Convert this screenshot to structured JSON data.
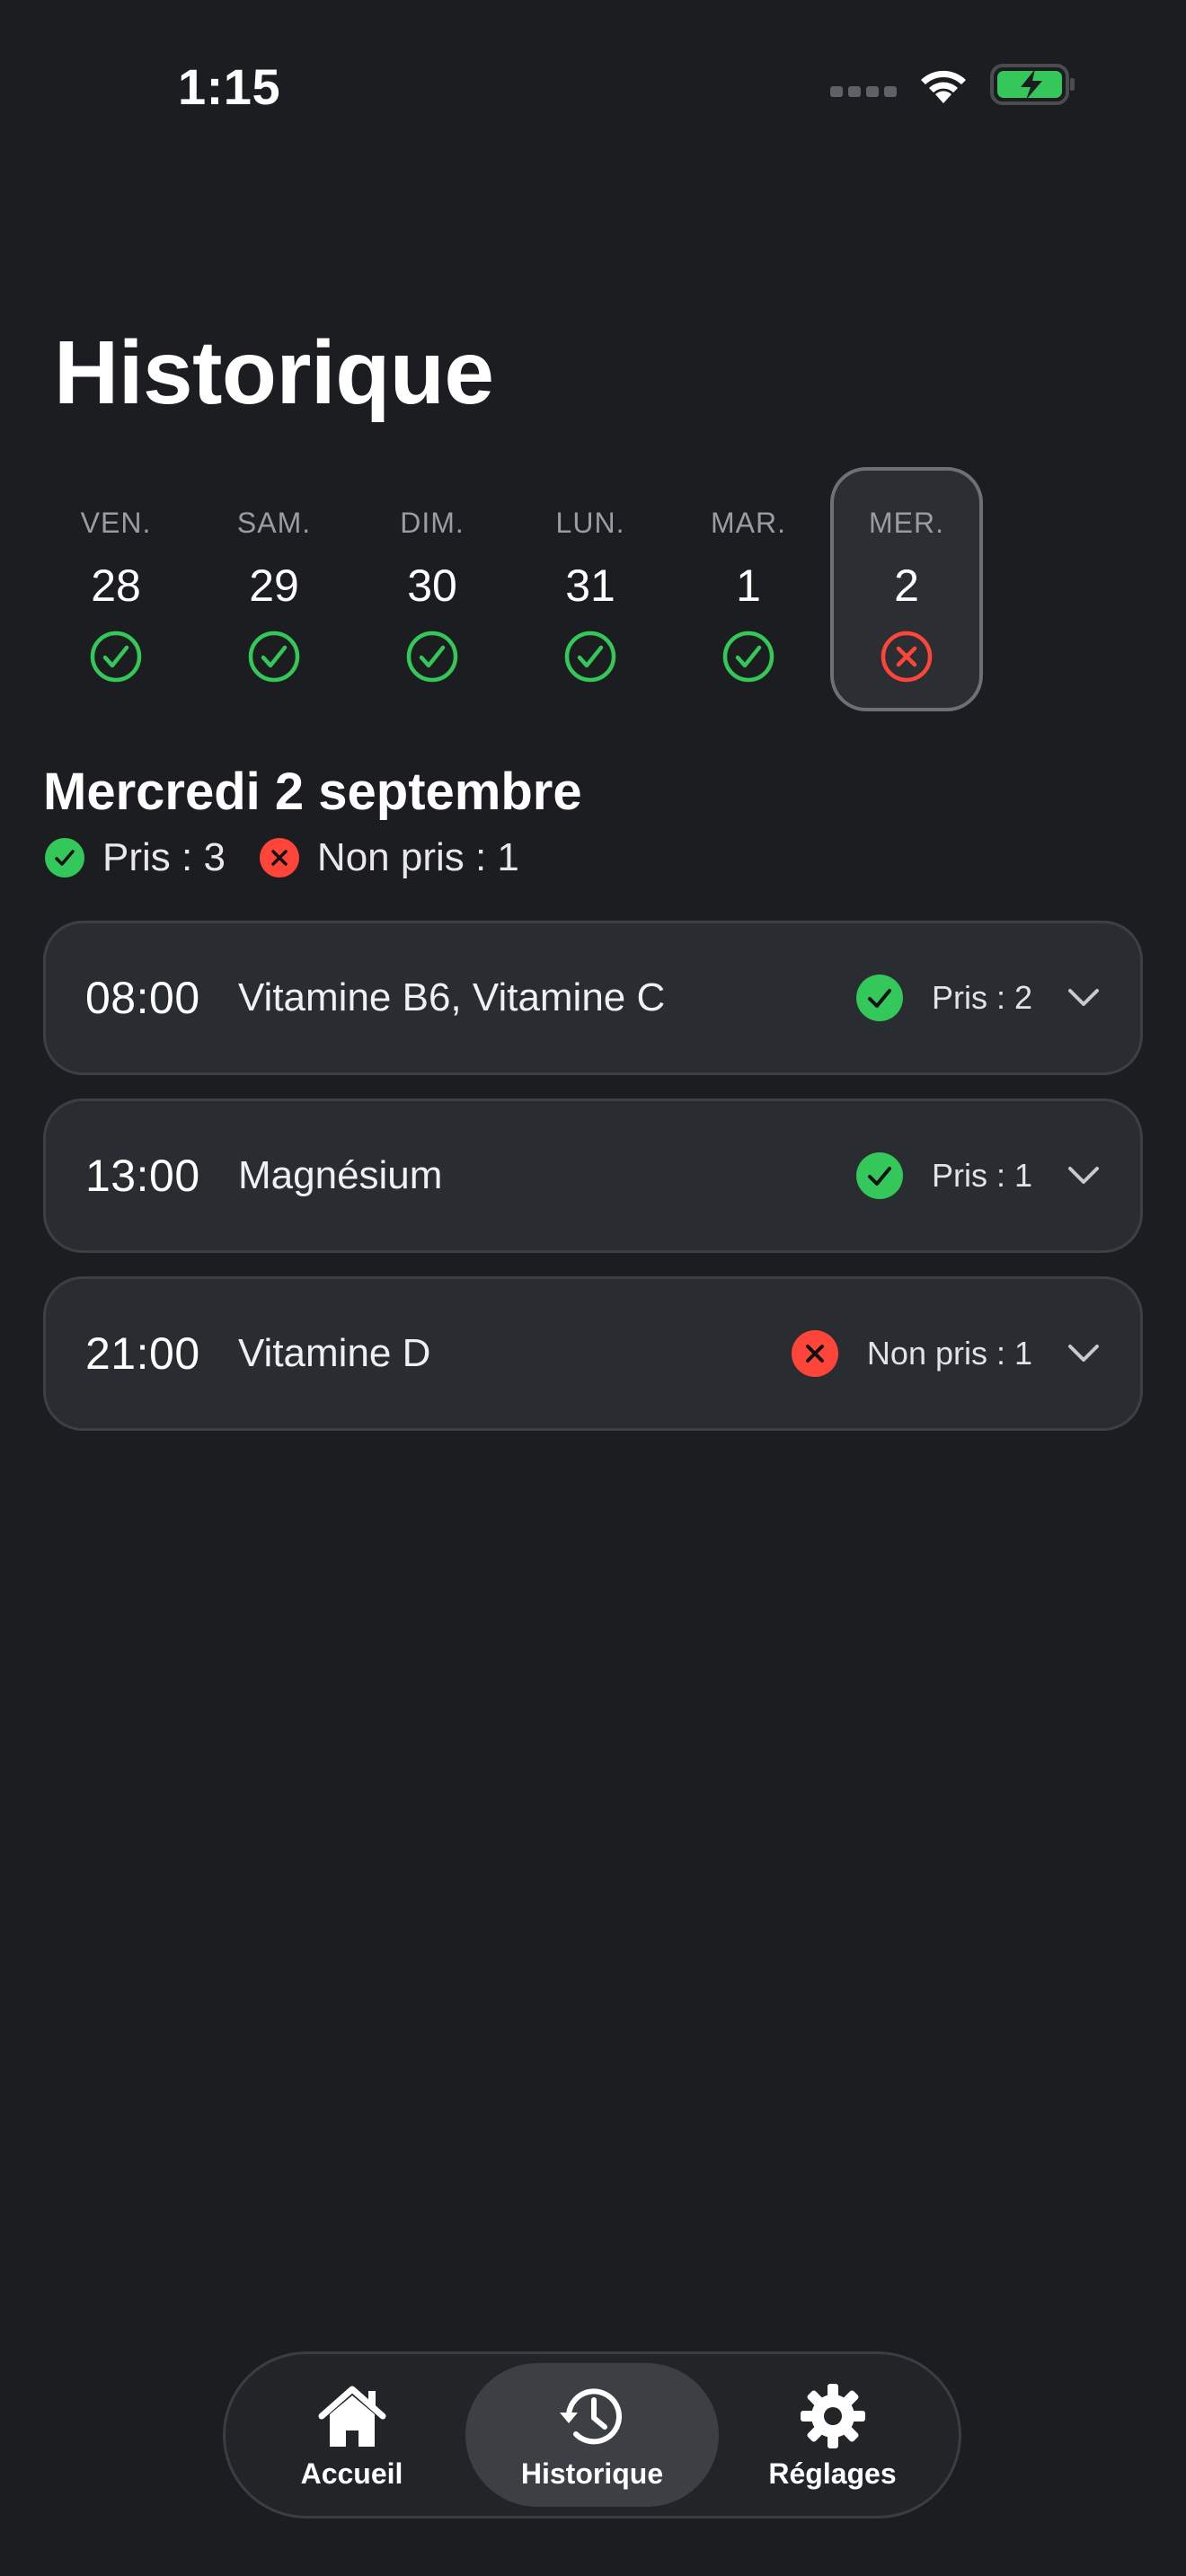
{
  "status_bar": {
    "time": "1:15",
    "icons": [
      "cellular-signal-icon",
      "wifi-icon",
      "battery-charging-icon"
    ]
  },
  "page": {
    "title": "Historique"
  },
  "colors": {
    "taken": "#34c759",
    "missed": "#ff453a",
    "background": "#1b1d20",
    "card": "#292c30"
  },
  "week": [
    {
      "name": "VEN.",
      "number": "28",
      "status": "taken"
    },
    {
      "name": "SAM.",
      "number": "29",
      "status": "taken"
    },
    {
      "name": "DIM.",
      "number": "30",
      "status": "taken"
    },
    {
      "name": "LUN.",
      "number": "31",
      "status": "taken"
    },
    {
      "name": "MAR.",
      "number": "1",
      "status": "taken"
    },
    {
      "name": "MER.",
      "number": "2",
      "status": "missed",
      "selected": true
    }
  ],
  "selected_day": {
    "heading": "Mercredi 2 septembre",
    "taken_label": "Pris : 3",
    "missed_label": "Non pris : 1"
  },
  "doses": [
    {
      "time": "08:00",
      "name": "Vitamine B6, Vitamine C",
      "status": "taken",
      "status_label": "Pris : 2"
    },
    {
      "time": "13:00",
      "name": "Magnésium",
      "status": "taken",
      "status_label": "Pris : 1"
    },
    {
      "time": "21:00",
      "name": "Vitamine D",
      "status": "missed",
      "status_label": "Non pris : 1"
    }
  ],
  "tabbar": {
    "tabs": [
      {
        "label": "Accueil",
        "icon": "house-icon"
      },
      {
        "label": "Historique",
        "icon": "history-clock-icon",
        "active": true
      },
      {
        "label": "Réglages",
        "icon": "gear-icon"
      }
    ]
  }
}
